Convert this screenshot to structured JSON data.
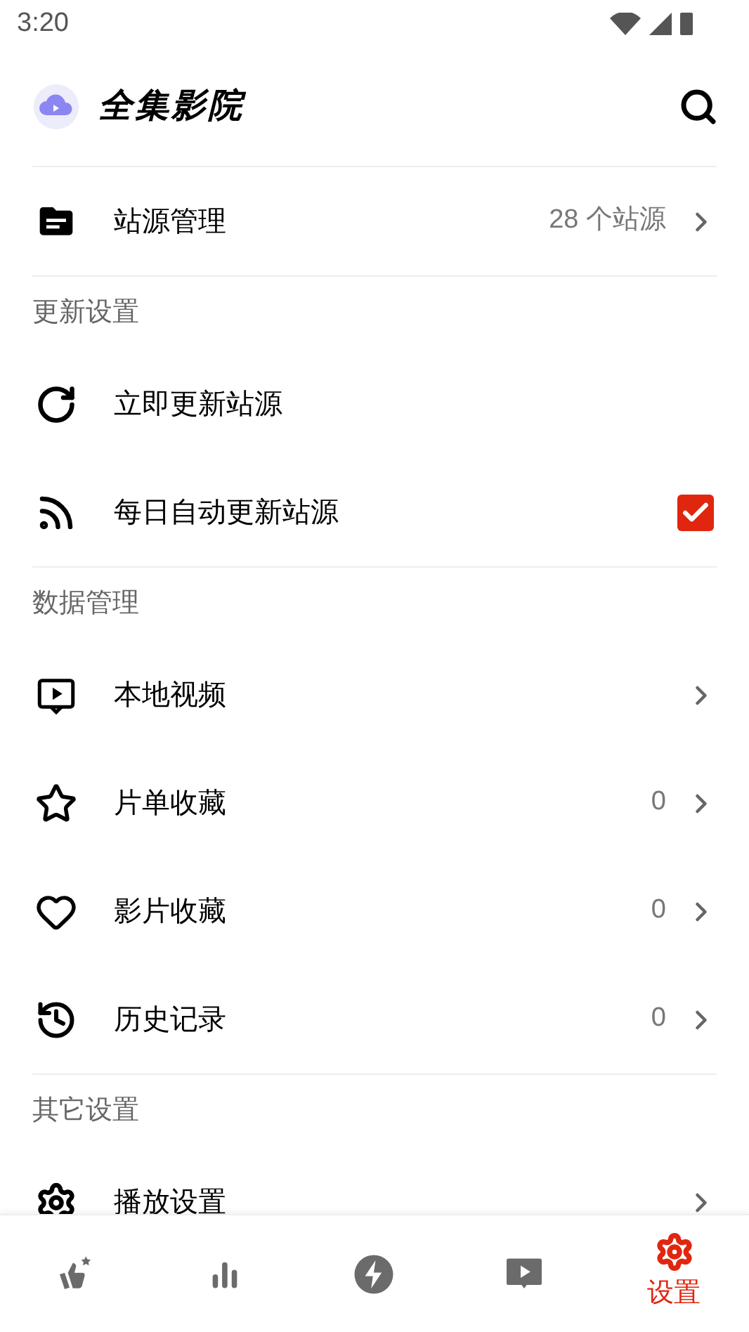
{
  "status_bar": {
    "time": "3:20"
  },
  "header": {
    "title": "全集影院"
  },
  "sections": [
    {
      "rows": [
        {
          "kind": "link",
          "label": "站源管理",
          "value": "28 个站源"
        }
      ]
    },
    {
      "title": "更新设置",
      "rows": [
        {
          "kind": "action",
          "label": "立即更新站源"
        },
        {
          "kind": "checkbox",
          "label": "每日自动更新站源",
          "checked": true
        }
      ]
    },
    {
      "title": "数据管理",
      "rows": [
        {
          "kind": "link",
          "label": "本地视频"
        },
        {
          "kind": "link",
          "label": "片单收藏",
          "value": "0"
        },
        {
          "kind": "link",
          "label": "影片收藏",
          "value": "0"
        },
        {
          "kind": "link",
          "label": "历史记录",
          "value": "0"
        }
      ]
    },
    {
      "title": "其它设置",
      "rows": [
        {
          "kind": "link",
          "label": "播放设置"
        }
      ]
    }
  ],
  "bottom_nav": [
    {
      "selected": false
    },
    {
      "selected": false
    },
    {
      "selected": false
    },
    {
      "selected": false
    },
    {
      "selected": true,
      "label": "设置"
    }
  ]
}
